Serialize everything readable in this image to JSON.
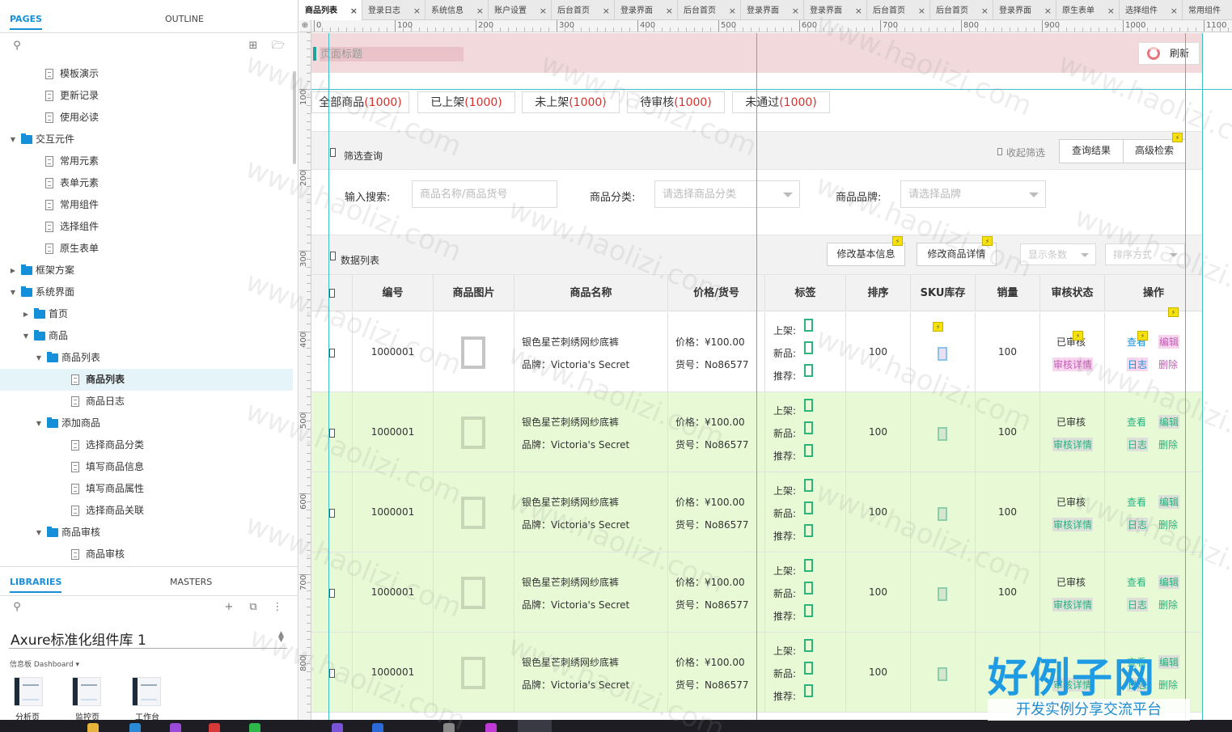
{
  "left_panel": {
    "tabs": [
      "PAGES",
      "OUTLINE"
    ],
    "tree": [
      {
        "label": "模板演示",
        "type": "page",
        "level": 1
      },
      {
        "label": "更新记录",
        "type": "page",
        "level": 1
      },
      {
        "label": "使用必读",
        "type": "page",
        "level": 1
      },
      {
        "label": "交互元件",
        "type": "folder",
        "level": 0,
        "state": "expanded"
      },
      {
        "label": "常用元素",
        "type": "page",
        "level": 1
      },
      {
        "label": "表单元素",
        "type": "page",
        "level": 1
      },
      {
        "label": "常用组件",
        "type": "page",
        "level": 1
      },
      {
        "label": "选择组件",
        "type": "page",
        "level": 1
      },
      {
        "label": "原生表单",
        "type": "page",
        "level": 1
      },
      {
        "label": "框架方案",
        "type": "folder",
        "level": 0,
        "state": "collapsed"
      },
      {
        "label": "系统界面",
        "type": "folder",
        "level": 0,
        "state": "expanded"
      },
      {
        "label": "首页",
        "type": "folder",
        "level": 1,
        "state": "collapsed"
      },
      {
        "label": "商品",
        "type": "folder",
        "level": 1,
        "state": "expanded"
      },
      {
        "label": "商品列表",
        "type": "folder",
        "level": 2,
        "state": "expanded"
      },
      {
        "label": "商品列表",
        "type": "page",
        "level": 3,
        "selected": true
      },
      {
        "label": "商品日志",
        "type": "page",
        "level": 3
      },
      {
        "label": "添加商品",
        "type": "folder",
        "level": 2,
        "state": "expanded"
      },
      {
        "label": "选择商品分类",
        "type": "page",
        "level": 3
      },
      {
        "label": "填写商品信息",
        "type": "page",
        "level": 3
      },
      {
        "label": "填写商品属性",
        "type": "page",
        "level": 3
      },
      {
        "label": "选择商品关联",
        "type": "page",
        "level": 3
      },
      {
        "label": "商品审核",
        "type": "folder",
        "level": 2,
        "state": "expanded"
      },
      {
        "label": "商品审核",
        "type": "page",
        "level": 3
      }
    ],
    "lib_tabs": [
      "LIBRARIES",
      "MASTERS"
    ],
    "library_name": "Axure标准化组件库 1",
    "library_group": "信息板 Dashboard ▾",
    "thumbnails": [
      "分析页",
      "监控页",
      "工作台"
    ]
  },
  "doc_tabs": [
    "商品列表",
    "登录日志",
    "系统信息",
    "账户设置",
    "后台首页",
    "登录界面",
    "后台首页",
    "登录界面",
    "登录界面",
    "后台首页",
    "后台首页",
    "登录界面",
    "原生表单",
    "选择组件",
    "常用组件"
  ],
  "ruler": {
    "h_labels": [
      "0",
      "100",
      "200",
      "300",
      "400",
      "500",
      "600",
      "700",
      "800",
      "900",
      "1000",
      "1100"
    ],
    "v_labels": [
      "100",
      "200",
      "300",
      "400",
      "500",
      "600",
      "700",
      "800"
    ]
  },
  "page": {
    "title_placeholder": "页面标题",
    "refresh_label": "刷新",
    "status_tabs": [
      {
        "label": "全部商品",
        "count": "(1000)"
      },
      {
        "label": "已上架",
        "count": "(1000)"
      },
      {
        "label": "未上架",
        "count": "(1000)"
      },
      {
        "label": "待审核",
        "count": "(1000)"
      },
      {
        "label": "未通过",
        "count": "(1000)"
      }
    ],
    "filter": {
      "title": "筛选查询",
      "collapse_label": "收起筛选",
      "query_button": "查询结果",
      "advanced_button": "高级检索",
      "search_label": "输入搜索:",
      "search_placeholder": "商品名称/商品货号",
      "category_label": "商品分类:",
      "category_placeholder": "请选择商品分类",
      "brand_label": "商品品牌:",
      "brand_placeholder": "请选择品牌"
    },
    "data_list": {
      "title": "数据列表",
      "edit_basic_button": "修改基本信息",
      "edit_detail_button": "修改商品详情",
      "page_size_placeholder": "显示条数",
      "sort_placeholder": "排序方式"
    },
    "table": {
      "headers": [
        "编号",
        "商品图片",
        "商品名称",
        "价格/货号",
        "标签",
        "排序",
        "SKU库存",
        "销量",
        "审核状态",
        "操作"
      ],
      "tag_labels": [
        "上架:",
        "新品:",
        "推荐:"
      ],
      "actions": {
        "view": "查看",
        "edit": "编辑",
        "log": "日志",
        "delete": "删除",
        "audit_detail": "审核详情"
      },
      "rows": [
        {
          "id": "1000001",
          "name": "银色星芒刺绣网纱底裤",
          "brand": "品牌：Victoria's Secret",
          "price": "价格：¥100.00",
          "sku": "货号：No86577",
          "sort": "100",
          "sales": "100",
          "status": "已审核"
        },
        {
          "id": "1000001",
          "name": "银色星芒刺绣网纱底裤",
          "brand": "品牌：Victoria's Secret",
          "price": "价格：¥100.00",
          "sku": "货号：No86577",
          "sort": "100",
          "sales": "100",
          "status": "已审核"
        },
        {
          "id": "1000001",
          "name": "银色星芒刺绣网纱底裤",
          "brand": "品牌：Victoria's Secret",
          "price": "价格：¥100.00",
          "sku": "货号：No86577",
          "sort": "100",
          "sales": "100",
          "status": "已审核"
        },
        {
          "id": "1000001",
          "name": "银色星芒刺绣网纱底裤",
          "brand": "品牌：Victoria's Secret",
          "price": "价格：¥100.00",
          "sku": "货号：No86577",
          "sort": "100",
          "sales": "100",
          "status": "已审核"
        },
        {
          "id": "1000001",
          "name": "银色星芒刺绣网纱底裤",
          "brand": "品牌：Victoria's Secret",
          "price": "价格：¥100.00",
          "sku": "货号：No86577",
          "sort": "100",
          "sales": "",
          "status": ""
        }
      ]
    }
  },
  "watermark": {
    "text": "www.haolizi.com",
    "brand_big": "好例子网",
    "brand_small": "开发实例分享交流平台"
  },
  "colors": {
    "accent": "#1a8fd6",
    "guide": "#3fc0c8",
    "count_red": "#d9302c",
    "row_highlight": "#e7fad5",
    "title_band": "#f2d9dc",
    "action_green": "#27b07e"
  }
}
